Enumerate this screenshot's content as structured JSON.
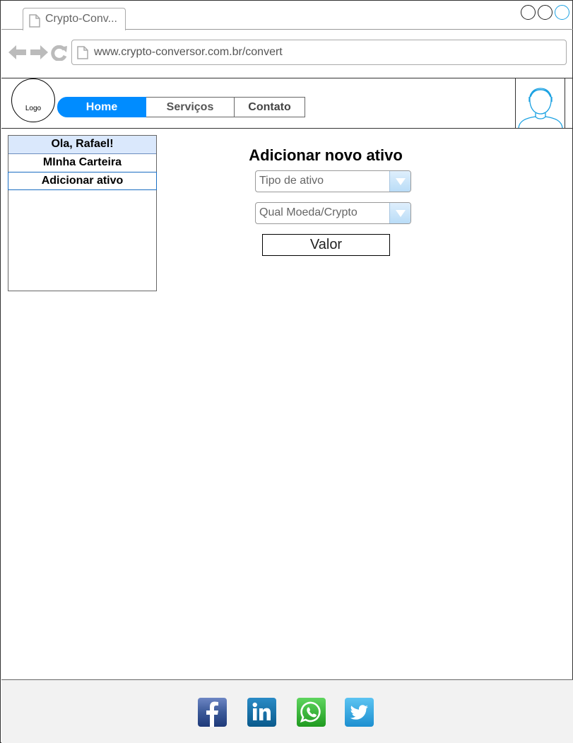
{
  "browser": {
    "tab_title": "Crypto-Conv...",
    "url": "www.crypto-conversor.com.br/convert"
  },
  "header": {
    "logo_text": "Logo",
    "nav": {
      "home": "Home",
      "servicos": "Serviços",
      "contato": "Contato"
    }
  },
  "sidebar": {
    "greeting": "Ola, Rafael!",
    "items": [
      "MInha Carteira",
      "Adicionar ativo"
    ]
  },
  "form": {
    "title": "Adicionar novo ativo",
    "tipo_ativo": "Tipo de ativo",
    "moeda": "Qual Moeda/Crypto",
    "valor": "Valor"
  },
  "colors": {
    "accent": "#008cff",
    "greeting_bg": "#dae8fc",
    "footer_bg": "#f2f2f2"
  },
  "footer": {
    "icons": [
      "facebook-icon",
      "linkedin-icon",
      "whatsapp-icon",
      "twitter-icon"
    ]
  }
}
